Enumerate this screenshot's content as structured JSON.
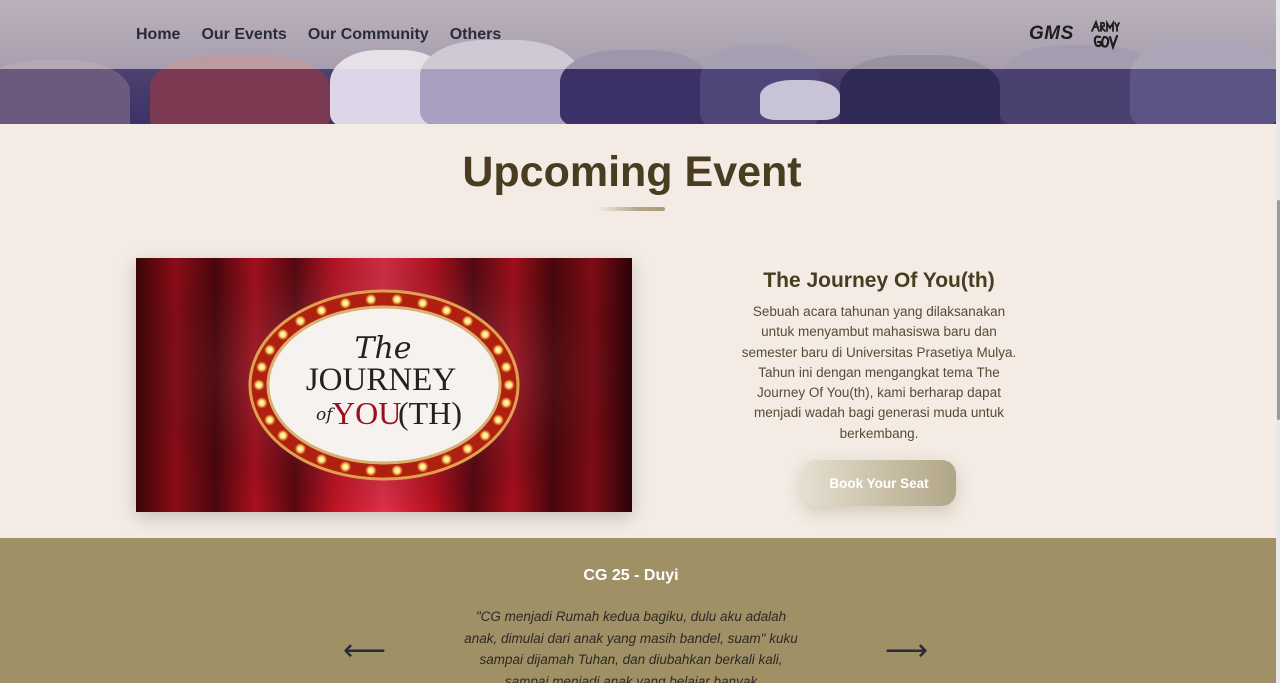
{
  "nav": {
    "links": [
      "Home",
      "Our Events",
      "Our Community",
      "Others"
    ],
    "logo_text": "GMS"
  },
  "upcoming": {
    "title": "Upcoming Event",
    "event": {
      "image_text": {
        "line1": "The",
        "line2": "JOURNEY",
        "line3a": "of",
        "line3b": "YOU",
        "line3c": "(TH)"
      },
      "name": "The Journey Of You(th)",
      "description": "Sebuah acara tahunan yang dilaksanakan untuk menyambut mahasiswa baru dan semester baru di Universitas Prasetiya Mulya. Tahun ini dengan mengangkat tema The Journey Of You(th), kami berharap dapat menjadi wadah bagi generasi muda untuk berkembang.",
      "button_label": "Book Your Seat"
    }
  },
  "testimonial": {
    "name": "CG 25 - Duyi",
    "quote": "\"CG menjadi Rumah kedua bagiku, dulu aku adalah anak, dimulai dari anak yang masih bandel, suam\" kuku sampai dijamah Tuhan, dan diubahkan berkali kali, sampai menjadi anak yang belajar banyak",
    "prev_arrow": "⟵",
    "next_arrow": "⟶"
  },
  "colors": {
    "heading": "#4a3c20",
    "page_bg": "#f3ebe4",
    "testimonial_bg": "#9f9066",
    "nav_text": "#2b2a3a"
  }
}
